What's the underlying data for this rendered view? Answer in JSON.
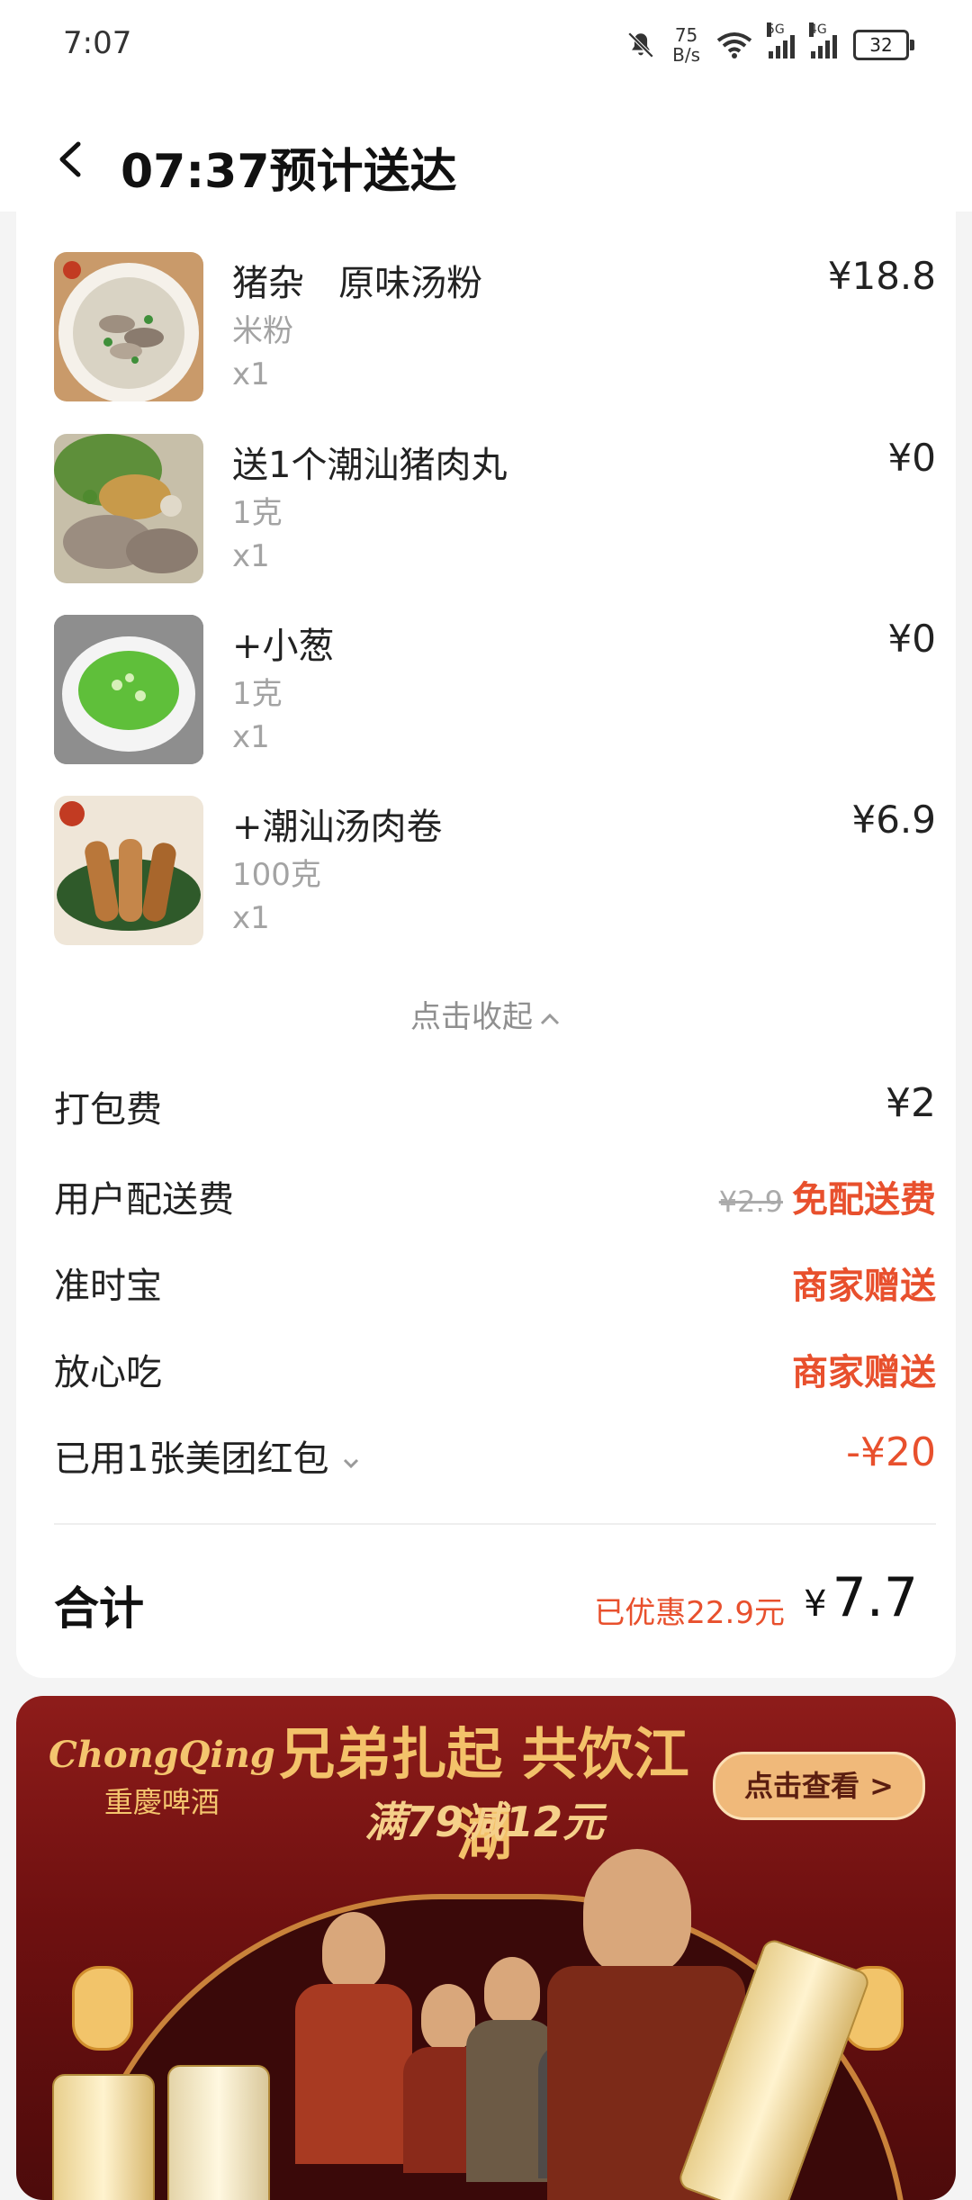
{
  "status_bar": {
    "time": "7:07",
    "net_speed_value": "75",
    "net_speed_unit": "B/s",
    "sig_tag_5g": "5G",
    "sig_tag_4g": "4G",
    "battery": "32"
  },
  "header": {
    "title": "07:37预计送达"
  },
  "items": [
    {
      "name": "猪杂   原味汤粉",
      "spec": "米粉",
      "qty": "x1",
      "price": "¥18.8"
    },
    {
      "name": "送1个潮汕猪肉丸",
      "spec": "1克",
      "qty": "x1",
      "price": "¥0"
    },
    {
      "name": "+小葱",
      "spec": "1克",
      "qty": "x1",
      "price": "¥0"
    },
    {
      "name": "+潮汕汤肉卷",
      "spec": "100克",
      "qty": "x1",
      "price": "¥6.9"
    }
  ],
  "collapse_label": "点击收起",
  "fees": {
    "packing": {
      "label": "打包费",
      "value": "¥2"
    },
    "delivery": {
      "label": "用户配送费",
      "original": "¥2.9",
      "value": "免配送费"
    },
    "ontime": {
      "label": "准时宝",
      "value": "商家赠送"
    },
    "safe_eat": {
      "label": "放心吃",
      "value": "商家赠送"
    },
    "red_packet": {
      "label": "已用1张美团红包",
      "value": "-¥20"
    }
  },
  "total": {
    "label": "合计",
    "saved": "已优惠22.9元",
    "currency": "¥",
    "value": "7.7"
  },
  "banner": {
    "brand_en": "ChongQing",
    "brand_cn": "重慶啤酒",
    "slogan": "兄弟扎起 共饮江湖",
    "promo": "满79减12元",
    "button": "点击查看 >"
  },
  "colors": {
    "accent": "#e8502d",
    "banner_bg": "#8e1c1a",
    "banner_gold": "#f3c26a"
  }
}
